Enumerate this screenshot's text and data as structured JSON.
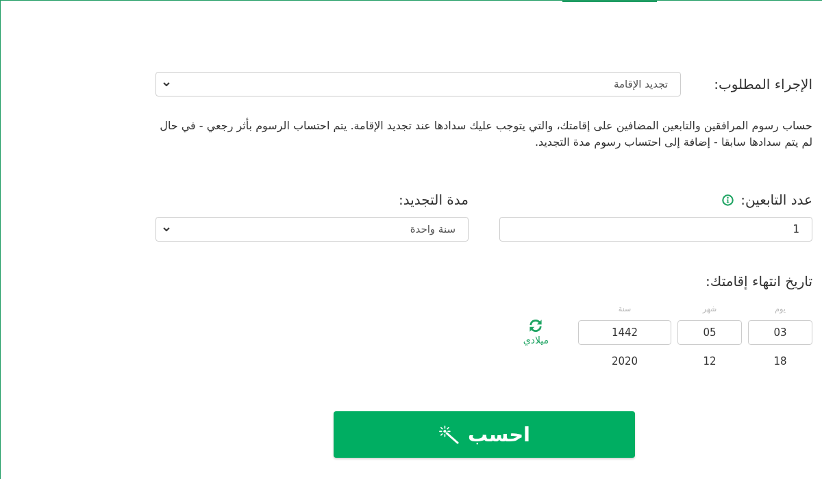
{
  "procedure": {
    "label": "الإجراء المطلوب:",
    "value": "تجديد الإقامة"
  },
  "description": "حساب رسوم المرافقين والتابعين المضافين على إقامتك، والتي يتوجب عليك سدادها عند تجديد الإقامة. يتم احتساب الرسوم بأثر رجعي - في حال لم يتم سدادها سابقا - إضافة إلى احتساب رسوم مدة التجديد.",
  "dependents": {
    "label": "عدد التابعين:",
    "value": "1"
  },
  "renewal_period": {
    "label": "مدة التجديد:",
    "value": "سنة واحدة"
  },
  "expiry_date": {
    "label": "تاريخ انتهاء إقامتك:",
    "fields": [
      {
        "kind": "day",
        "label": "يوم",
        "value": "03",
        "converted": "18"
      },
      {
        "kind": "month",
        "label": "شهر",
        "value": "05",
        "converted": "12"
      },
      {
        "kind": "year",
        "label": "سنة",
        "value": "1442",
        "converted": "2020"
      }
    ],
    "toggle": {
      "label": "ميلادي"
    }
  },
  "submit": {
    "label": "احسب"
  }
}
